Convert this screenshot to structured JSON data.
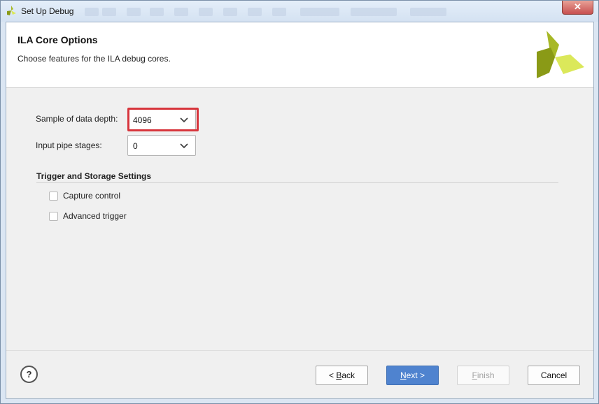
{
  "window": {
    "title": "Set Up Debug",
    "close_label": "✕"
  },
  "header": {
    "title": "ILA Core Options",
    "subtitle": "Choose features for the ILA debug cores."
  },
  "form": {
    "sample_depth": {
      "label": "Sample of data depth:",
      "value": "4096"
    },
    "pipe_stages": {
      "label": "Input pipe stages:",
      "value": "0"
    }
  },
  "trigger": {
    "section_title": "Trigger and Storage Settings",
    "capture_control": {
      "label": "Capture control",
      "checked": false
    },
    "advanced_trigger": {
      "label": "Advanced trigger",
      "checked": false
    }
  },
  "footer": {
    "help_label": "?",
    "back": {
      "prefix": "< ",
      "mnemonic": "B",
      "rest": "ack"
    },
    "next": {
      "mnemonic": "N",
      "rest": "ext >"
    },
    "finish": {
      "mnemonic": "F",
      "rest": "inish"
    },
    "cancel": "Cancel"
  },
  "colors": {
    "highlight": "#d7353c",
    "primary_button": "#4f83cf",
    "logo_dark": "#8a9a16",
    "logo_light": "#dbe85a"
  }
}
